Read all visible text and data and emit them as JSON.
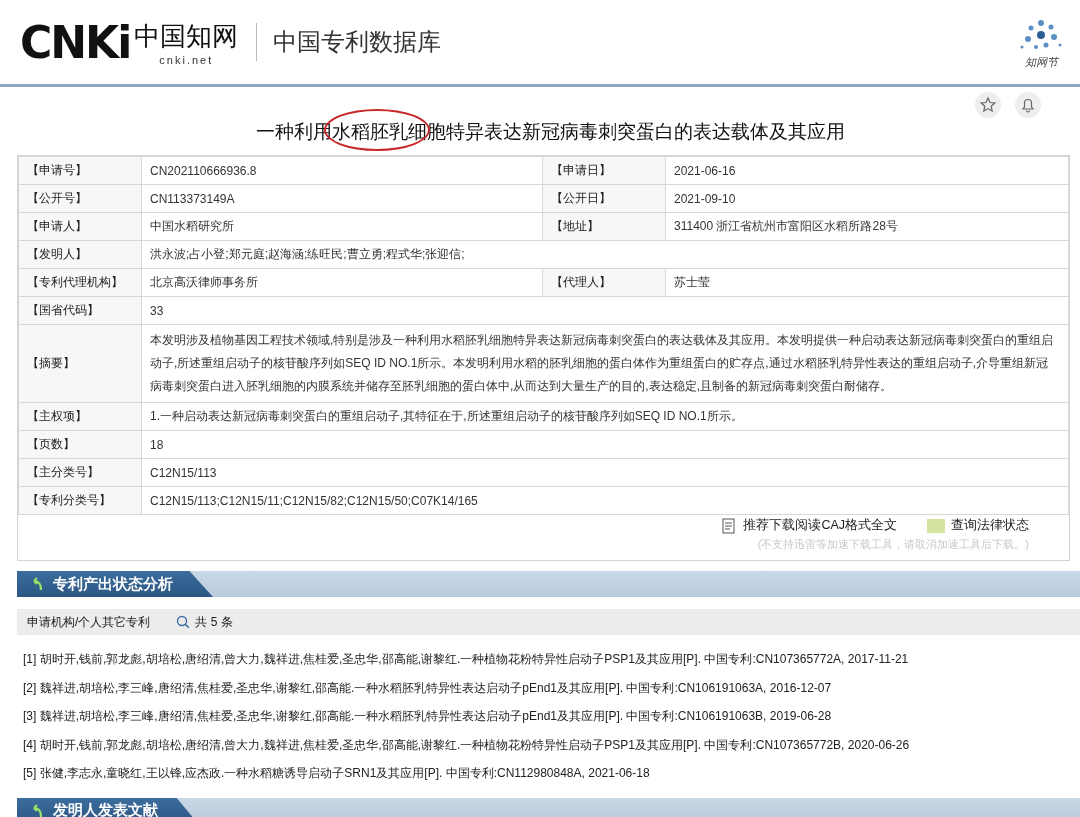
{
  "header": {
    "logo_letters": "CNKi",
    "logo_cn": "中国知网",
    "logo_domain": "cnki.net",
    "site_title": "中国专利数据库",
    "corner_caption": "知网节"
  },
  "title": {
    "text": "一种利用水稻胚乳细胞特异表达新冠病毒刺突蛋白的表达载体及其应用"
  },
  "fields": [
    [
      {
        "label": "【申请号】",
        "value": "CN202110666936.8"
      },
      {
        "label": "【申请日】",
        "value": "2021-06-16"
      }
    ],
    [
      {
        "label": "【公开号】",
        "value": "CN113373149A"
      },
      {
        "label": "【公开日】",
        "value": "2021-09-10"
      }
    ],
    [
      {
        "label": "【申请人】",
        "value": "中国水稻研究所"
      },
      {
        "label": "【地址】",
        "value": "311400 浙江省杭州市富阳区水稻所路28号"
      }
    ],
    [
      {
        "label": "【发明人】",
        "value": "洪永波;占小登;郑元庭;赵海涵;练旺民;曹立勇;程式华;张迎信;"
      }
    ],
    [
      {
        "label": "【专利代理机构】",
        "value": "北京高沃律师事务所"
      },
      {
        "label": "【代理人】",
        "value": "苏士莹"
      }
    ],
    [
      {
        "label": "【国省代码】",
        "value": "33"
      }
    ],
    [
      {
        "label": "【摘要】",
        "value": "本发明涉及植物基因工程技术领域,特别是涉及一种利用水稻胚乳细胞特异表达新冠病毒刺突蛋白的表达载体及其应用。本发明提供一种启动表达新冠病毒刺突蛋白的重组启动子,所述重组启动子的核苷酸序列如SEQ ID NO.1所示。本发明利用水稻的胚乳细胞的蛋白体作为重组蛋白的贮存点,通过水稻胚乳特异性表达的重组启动子,介导重组新冠病毒刺突蛋白进入胚乳细胞的内膜系统并储存至胚乳细胞的蛋白体中,从而达到大量生产的目的,表达稳定,且制备的新冠病毒刺突蛋白耐储存。"
      }
    ],
    [
      {
        "label": "【主权项】",
        "value": "1.一种启动表达新冠病毒刺突蛋白的重组启动子,其特征在于,所述重组启动子的核苷酸序列如SEQ ID NO.1所示。"
      }
    ],
    [
      {
        "label": "【页数】",
        "value": "18"
      }
    ],
    [
      {
        "label": "【主分类号】",
        "value": "C12N15/113"
      }
    ],
    [
      {
        "label": "【专利分类号】",
        "value": "C12N15/113;C12N15/11;C12N15/82;C12N15/50;C07K14/165"
      }
    ]
  ],
  "downloads": {
    "links": [
      {
        "kind": "caj",
        "label": "推荐下载阅读CAJ格式全文"
      },
      {
        "kind": "legal",
        "label": "查询法律状态"
      }
    ],
    "note": "(不支持迅雷等加速下载工具，请取消加速工具后下载。)"
  },
  "section_1": {
    "title": "专利产出状态分析",
    "subheading": "申请机构/个人其它专利",
    "count": "共 5 条",
    "references": [
      "[1] 胡时开,钱前,郭龙彪,胡培松,唐绍清,曾大力,魏祥进,焦桂爱,圣忠华,邵高能,谢黎红.一种植物花粉特异性启动子PSP1及其应用[P]. 中国专利:CN107365772A, 2017-11-21",
      "[2] 魏祥进,胡培松,李三峰,唐绍清,焦桂爱,圣忠华,谢黎红,邵高能.一种水稻胚乳特异性表达启动子pEnd1及其应用[P]. 中国专利:CN106191063A, 2016-12-07",
      "[3] 魏祥进,胡培松,李三峰,唐绍清,焦桂爱,圣忠华,谢黎红,邵高能.一种水稻胚乳特异性表达启动子pEnd1及其应用[P]. 中国专利:CN106191063B, 2019-06-28",
      "[4] 胡时开,钱前,郭龙彪,胡培松,唐绍清,曾大力,魏祥进,焦桂爱,圣忠华,邵高能,谢黎红.一种植物花粉特异性启动子PSP1及其应用[P]. 中国专利:CN107365772B, 2020-06-26",
      "[5] 张健,李志永,童晓红,王以锋,应杰政.一种水稻糖诱导启动子SRN1及其应用[P]. 中国专利:CN112980848A, 2021-06-18"
    ]
  },
  "section_2": {
    "title": "发明人发表文献"
  }
}
